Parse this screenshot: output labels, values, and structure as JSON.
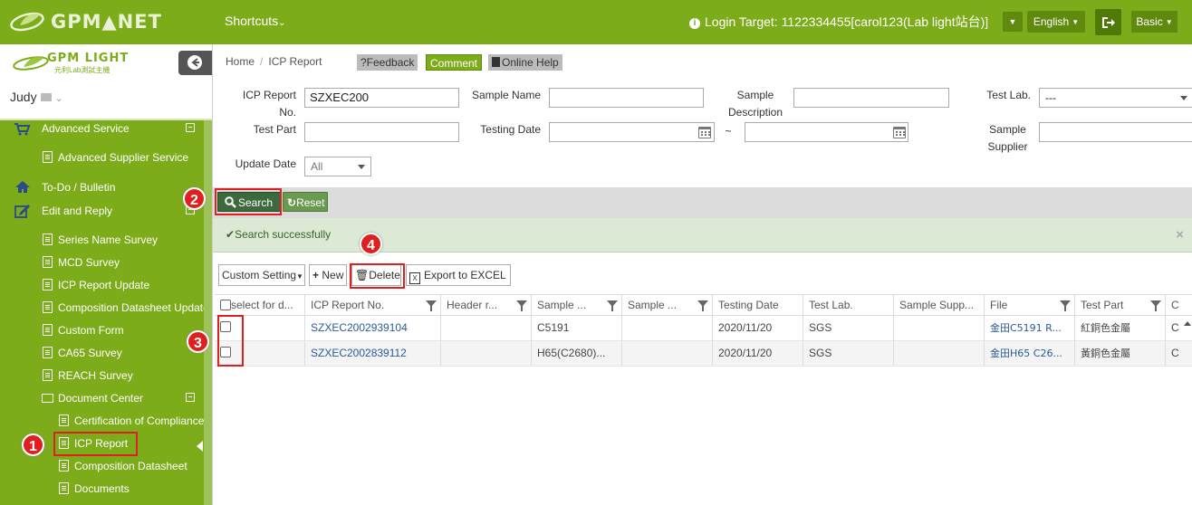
{
  "topbar": {
    "logo_text": "GPM▲NET",
    "shortcuts": "Shortcuts",
    "login_target": "Login Target: 1122334455[carol123(Lab light站台)]",
    "language": "English",
    "mode": "Basic"
  },
  "sidebar": {
    "brand_logo_text": "GPM LIGHT",
    "brand_sub": "元利Lab測試主機",
    "user": "Judy",
    "items": [
      {
        "label": "Advanced Service"
      },
      {
        "label": "Advanced Supplier Service"
      },
      {
        "label": "To-Do / Bulletin"
      },
      {
        "label": "Edit and Reply"
      },
      {
        "label": "Series Name Survey"
      },
      {
        "label": "MCD Survey"
      },
      {
        "label": "ICP Report Update"
      },
      {
        "label": "Composition Datasheet Update"
      },
      {
        "label": "Custom Form"
      },
      {
        "label": "CA65 Survey"
      },
      {
        "label": "REACH Survey"
      },
      {
        "label": "Document Center"
      },
      {
        "label": "Certification of Compliance"
      },
      {
        "label": "ICP Report"
      },
      {
        "label": "Composition Datasheet"
      },
      {
        "label": "Documents"
      }
    ]
  },
  "header": {
    "breadcrumb_home": "Home",
    "breadcrumb_sep": "/",
    "breadcrumb_current": "ICP Report",
    "feedback": "?Feedback",
    "comment": "Comment",
    "online_help": "Online Help"
  },
  "filters": {
    "icp_report_no_label": "ICP Report No.",
    "icp_report_no_value": "SZXEC200",
    "sample_name_label": "Sample Name",
    "sample_description_label": "Sample Description",
    "test_lab_label": "Test Lab.",
    "test_lab_value": "---",
    "test_part_label": "Test Part",
    "testing_date_label": "Testing Date",
    "date_sep": "~",
    "sample_supplier_label": "Sample Supplier",
    "update_date_label": "Update Date",
    "update_date_value": "All"
  },
  "search_bar": {
    "search": "Search",
    "reset": "Reset"
  },
  "alert": {
    "message": "Search successfully",
    "close": "×"
  },
  "toolbar": {
    "custom_setting": "Custom Setting",
    "new": "New",
    "delete": "Delete",
    "export": "Export to EXCEL"
  },
  "grid": {
    "columns": [
      "select for d...",
      "ICP Report No.",
      "Header r...",
      "Sample ...",
      "Sample ...",
      "Testing Date",
      "Test Lab.",
      "Sample Supp...",
      "File",
      "Test Part",
      "C"
    ],
    "rows": [
      {
        "report_no": "SZXEC2002939104",
        "header": "",
        "sample1": "C5191",
        "sample2": "",
        "date": "2020/11/20",
        "lab": "SGS",
        "supplier": "",
        "file": "金田C5191 R...",
        "part": "紅銅色金屬",
        "c": "C"
      },
      {
        "report_no": "SZXEC2002839112",
        "header": "",
        "sample1": "H65(C2680)...",
        "sample2": "",
        "date": "2020/11/20",
        "lab": "SGS",
        "supplier": "",
        "file": "金田H65 C26...",
        "part": "黃銅色金屬",
        "c": "C"
      }
    ]
  },
  "annotations": [
    "1",
    "2",
    "3",
    "4"
  ],
  "colors": {
    "brand_green": "#7cac1a",
    "dark_green": "#5f8a0e",
    "search_green": "#3c6a3c",
    "highlight_red": "#e02020",
    "alert_bg": "#dbe9d5"
  }
}
